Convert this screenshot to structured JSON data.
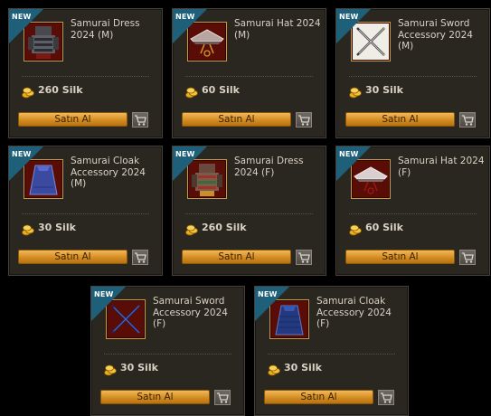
{
  "badge_label": "NEW",
  "buy_label": "Satın Al",
  "items": [
    {
      "title": "Samurai Dress 2024 (M)",
      "price": "260 Silk",
      "icon": "samurai-armor-icon"
    },
    {
      "title": "Samurai Hat 2024 (M)",
      "price": "60 Silk",
      "icon": "samurai-hat-icon"
    },
    {
      "title": "Samurai Sword Accessory 2024 (M)",
      "price": "30 Silk",
      "icon": "crossed-swords-icon"
    },
    {
      "title": "Samurai Cloak Accessory 2024 (M)",
      "price": "30 Silk",
      "icon": "cloak-icon"
    },
    {
      "title": "Samurai Dress 2024 (F)",
      "price": "260 Silk",
      "icon": "samurai-armor-icon"
    },
    {
      "title": "Samurai Hat 2024 (F)",
      "price": "60 Silk",
      "icon": "samurai-hat-icon"
    },
    {
      "title": "Samurai Sword Accessory 2024 (F)",
      "price": "30 Silk",
      "icon": "crossed-swords-icon"
    },
    {
      "title": "Samurai Cloak Accessory 2024 (F)",
      "price": "30 Silk",
      "icon": "cloak-icon"
    }
  ],
  "colors": {
    "buy_button": "#d48d22",
    "new_badge": "#1e5f7a",
    "card_bg": "#2a2620",
    "thumb_border": "#c69a3e"
  }
}
